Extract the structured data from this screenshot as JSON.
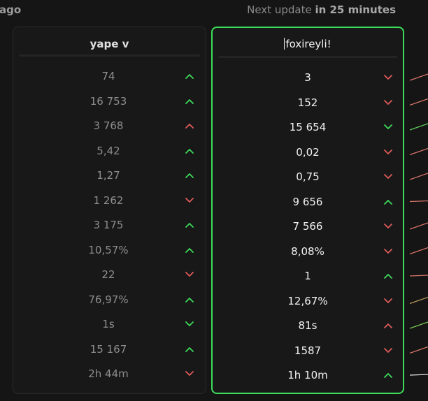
{
  "header": {
    "left_fragment": "ago",
    "next_update_prefix": "Next update ",
    "next_update_value": "in 25 minutes"
  },
  "columns": [
    {
      "title": "yape v",
      "rows": [
        {
          "value": "74",
          "trend": "up",
          "color": "#3ddc5a"
        },
        {
          "value": "16 753",
          "trend": "up",
          "color": "#3ddc5a"
        },
        {
          "value": "3 768",
          "trend": "up",
          "color": "#e05a5a"
        },
        {
          "value": "5,42",
          "trend": "up",
          "color": "#3ddc5a"
        },
        {
          "value": "1,27",
          "trend": "up",
          "color": "#3ddc5a"
        },
        {
          "value": "1 262",
          "trend": "down",
          "color": "#e05a5a"
        },
        {
          "value": "3 175",
          "trend": "up",
          "color": "#3ddc5a"
        },
        {
          "value": "10,57%",
          "trend": "up",
          "color": "#3ddc5a"
        },
        {
          "value": "22",
          "trend": "down",
          "color": "#e05a5a"
        },
        {
          "value": "76,97%",
          "trend": "up",
          "color": "#3ddc5a"
        },
        {
          "value": "1s",
          "trend": "down",
          "color": "#3ddc5a"
        },
        {
          "value": "15 167",
          "trend": "up",
          "color": "#3ddc5a"
        },
        {
          "value": "2h 44m",
          "trend": "down",
          "color": "#e05a5a"
        }
      ]
    },
    {
      "title": "foxireyli!",
      "rows": [
        {
          "value": "3",
          "trend": "down",
          "color": "#e05a5a"
        },
        {
          "value": "152",
          "trend": "down",
          "color": "#e05a5a"
        },
        {
          "value": "15 654",
          "trend": "down",
          "color": "#3ddc5a"
        },
        {
          "value": "0,02",
          "trend": "down",
          "color": "#e05a5a"
        },
        {
          "value": "0,75",
          "trend": "down",
          "color": "#e05a5a"
        },
        {
          "value": "9 656",
          "trend": "up",
          "color": "#3ddc5a"
        },
        {
          "value": "7 566",
          "trend": "down",
          "color": "#e05a5a"
        },
        {
          "value": "8,08%",
          "trend": "down",
          "color": "#e05a5a"
        },
        {
          "value": "1",
          "trend": "up",
          "color": "#3ddc5a"
        },
        {
          "value": "12,67%",
          "trend": "down",
          "color": "#e05a5a"
        },
        {
          "value": "81s",
          "trend": "up",
          "color": "#e05a5a"
        },
        {
          "value": "1587",
          "trend": "down",
          "color": "#e05a5a"
        },
        {
          "value": "1h 10m",
          "trend": "up",
          "color": "#3ddc5a"
        }
      ]
    }
  ],
  "sparklines": [
    {
      "color": "#d9776a",
      "direction": "rise"
    },
    {
      "color": "#d9776a",
      "direction": "rise"
    },
    {
      "color": "#5fcf5a",
      "direction": "rise"
    },
    {
      "color": "#d9776a",
      "direction": "rise"
    },
    {
      "color": "#d9776a",
      "direction": "rise"
    },
    {
      "color": "#d9776a",
      "direction": "flat"
    },
    {
      "color": "#d9776a",
      "direction": "rise"
    },
    {
      "color": "#d9776a",
      "direction": "rise"
    },
    {
      "color": "#d9776a",
      "direction": "flat"
    },
    {
      "color": "#b99a5a",
      "direction": "rise"
    },
    {
      "color": "#7fc85a",
      "direction": "rise"
    },
    {
      "color": "#d9776a",
      "direction": "rise"
    },
    {
      "color": "#e8e8e8",
      "direction": "flat"
    }
  ]
}
